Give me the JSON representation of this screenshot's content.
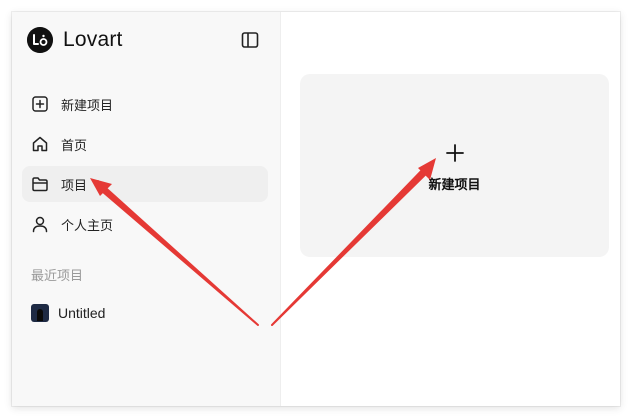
{
  "app": {
    "name": "Lovart",
    "logo_icon": "lovart-logo-icon"
  },
  "sidebar": {
    "toggle_icon": "sidebar-toggle-icon",
    "nav": [
      {
        "label": "新建项目",
        "icon": "plus-square-icon"
      },
      {
        "label": "首页",
        "icon": "home-icon"
      },
      {
        "label": "项目",
        "icon": "folder-icon",
        "active": true
      },
      {
        "label": "个人主页",
        "icon": "user-icon"
      }
    ],
    "recent_title": "最近项目",
    "recent": [
      {
        "label": "Untitled"
      }
    ]
  },
  "main": {
    "new_project_card": {
      "label": "新建项目",
      "icon": "plus-icon"
    }
  },
  "annotation": {
    "color": "#e53935"
  }
}
